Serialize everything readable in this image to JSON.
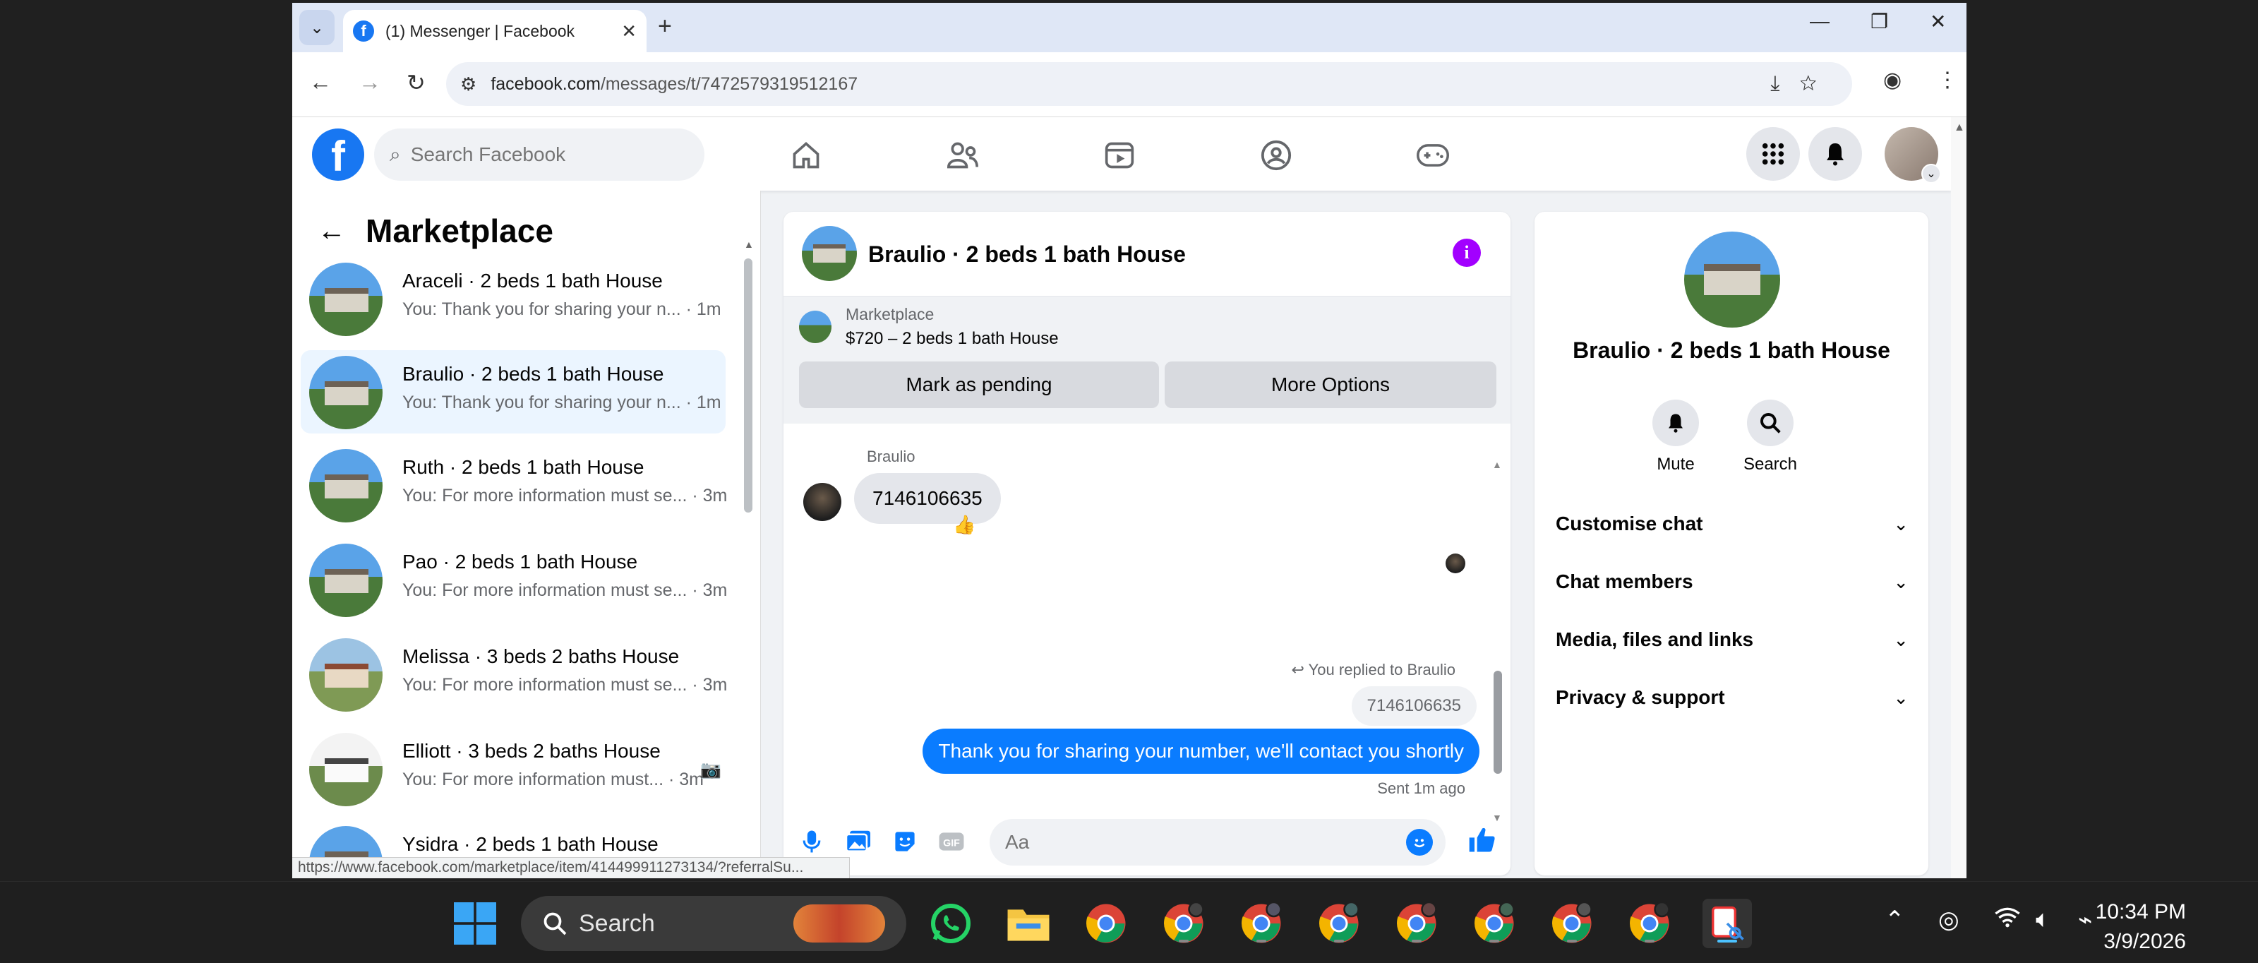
{
  "browser": {
    "tab_title": "(1) Messenger | Facebook",
    "url_host": "facebook.com",
    "url_path": "/messages/t/7472579319512167",
    "status_url": "https://www.facebook.com/marketplace/item/414499911273134/?referralSu..."
  },
  "fb": {
    "search_placeholder": "Search Facebook"
  },
  "left_panel": {
    "title": "Marketplace",
    "conversations": [
      {
        "name": "Araceli · 2 beds 1 bath House",
        "preview": "You: Thank you for sharing your n... · 1m",
        "selected": false
      },
      {
        "name": "Braulio · 2 beds 1 bath House",
        "preview": "You: Thank you for sharing your n... · 1m",
        "selected": true
      },
      {
        "name": "Ruth · 2 beds 1 bath House",
        "preview": "You: For more information must se... · 3m",
        "selected": false
      },
      {
        "name": "Pao · 2 beds 1 bath House",
        "preview": "You: For more information must se... · 3m",
        "selected": false
      },
      {
        "name": "Melissa · 3 beds 2 baths House",
        "preview": "You: For more information must se... · 3m",
        "selected": false
      },
      {
        "name": "Elliott · 3 beds 2 baths House",
        "preview": "You: For more information must... · 3m",
        "selected": false
      },
      {
        "name": "Ysidra · 2 beds 1 bath House",
        "preview": "",
        "selected": false
      }
    ]
  },
  "chat": {
    "title": "Braulio · 2 beds 1 bath House",
    "marketplace_label": "Marketplace",
    "listing": "$720 – 2 beds 1 bath House",
    "btn_pending": "Mark as pending",
    "btn_more": "More Options",
    "sender_name": "Braulio",
    "incoming_message": "7146106635",
    "reaction": "👍",
    "replied_label": "You replied to Braulio",
    "quoted_message": "7146106635",
    "outgoing_message": "Thank you for sharing your number, we'll contact you shortly",
    "sent_status": "Sent 1m ago",
    "composer_placeholder": "Aa"
  },
  "right_panel": {
    "name": "Braulio · 2 beds 1 bath House",
    "mute_label": "Mute",
    "search_label": "Search",
    "sections": [
      "Customise chat",
      "Chat members",
      "Media, files and links",
      "Privacy & support"
    ]
  },
  "taskbar": {
    "search_label": "Search",
    "time": "10:34 PM",
    "date": "3/9/2026"
  },
  "colors": {
    "fb_blue": "#1877f2",
    "messenger_blue": "#0a7cff",
    "info_purple": "#a200ff",
    "selected_bg": "#ebf5ff"
  }
}
